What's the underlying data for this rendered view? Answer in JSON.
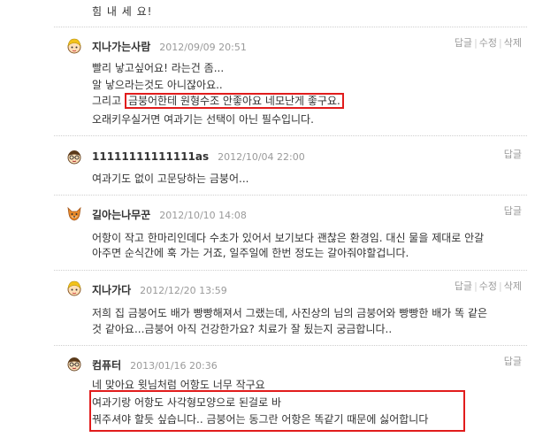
{
  "top_line": "힘 내 세 요!",
  "actions": {
    "reply": "답글",
    "edit": "수정",
    "delete": "삭제"
  },
  "comments": [
    {
      "author": "지나가는사람",
      "date": "2012/09/09 20:51",
      "lines": [
        "빨리 낳고싶어요! 라는건 좀...",
        "알 낳으라는것도 아니잖아요..",
        {
          "pre": "그리고 ",
          "highlight": "금붕어한테 원형수조 안좋아요 네모난게 좋구요."
        },
        "오래키우실거면 여과기는 선택이 아닌 필수입니다."
      ]
    },
    {
      "author": "11111111111111as",
      "date": "2012/10/04 22:00",
      "lines": [
        "여과기도 없이 고문당하는 금붕어..."
      ]
    },
    {
      "author": "길아는나무꾼",
      "date": "2012/10/10 14:08",
      "lines": [
        "어항이 작고 한마리인데다 수초가 있어서 보기보다 괜찮은 환경임. 대신 물을 제대로 안갈",
        "아주면 순식간에 훅 가는 거죠, 일주일에 한번 정도는 갈아줘야할겁니다."
      ]
    },
    {
      "author": "지나가다",
      "date": "2012/12/20 13:59",
      "lines": [
        "저희 집 금붕어도 배가 빵빵해져서 그랬는데, 사진상의 님의 금붕어와 빵빵한 배가 똑 같은",
        "것 같아요...금붕어 아직 건강한가요? 치료가 잘 됬는지 궁금합니다.."
      ]
    },
    {
      "author": "컴퓨터",
      "date": "2013/01/16 20:36",
      "lines": [
        "네 맞아요 윗님처럼 어항도 너무 작구요",
        "여과기랑 어항도 사각형모양으로 된걸로 바",
        "꿔주셔야 할듯 싶습니다.. 금붕어는 동그란 어항은 똑같기 때문에 싫어합니다"
      ]
    }
  ]
}
